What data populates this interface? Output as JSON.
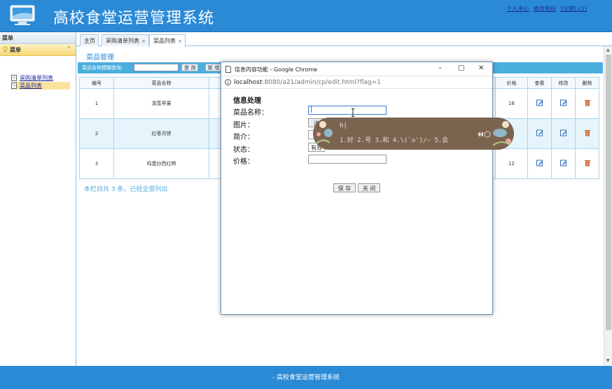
{
  "header": {
    "app_title": "高校食堂运营管理系统",
    "links": [
      "个人中心",
      "修改密码",
      "[注销]:c1)"
    ]
  },
  "sidebar": {
    "head": "菜单",
    "group": "菜单",
    "items": [
      {
        "label": "采购清单列表",
        "active": false
      },
      {
        "label": "菜品列表",
        "active": true
      }
    ]
  },
  "tabs": [
    {
      "label": "主页",
      "closable": false
    },
    {
      "label": "采购清单列表",
      "closable": true
    },
    {
      "label": "菜品列表",
      "closable": true,
      "active": true
    }
  ],
  "main": {
    "panel_title": "菜品管理",
    "search_label": "菜品名称模糊查询:",
    "search_value": "",
    "query_button": "查 询",
    "add_button": "新 增",
    "columns": [
      "编号",
      "菜品名称",
      "价格",
      "查看",
      "修改",
      "删除"
    ],
    "rows": [
      {
        "id": "1",
        "name": "清蒸苹果",
        "price": "16"
      },
      {
        "id": "2",
        "name": "红枣月饼",
        "price": ""
      },
      {
        "id": "3",
        "name": "鸡蛋炒西红柿",
        "price": "12"
      }
    ],
    "footnote": "本栏目共 3 条，已经全部列出"
  },
  "popup": {
    "title": "信息内容功能 - Google Chrome",
    "url_host": "localhost",
    "url_rest": ":8080/a21/admin/cp/edit.html?flag=1",
    "form_heading": "信息处理",
    "fields": {
      "name_label": "菜品名称：",
      "name_value": "|",
      "image_label": "图片：",
      "image_button": "选",
      "intro_label": "简介：",
      "status_label": "状态：",
      "status_value": "有效",
      "price_label": "价格：",
      "price_value": ""
    },
    "save_button": "保 存",
    "close_button": "关 闭"
  },
  "ime": {
    "typed": "h|",
    "candidates": "1.好  2.号  3.和  4.\\(`o')/~ 5.会"
  },
  "footer": {
    "text": "- 高校食堂运营管理系统"
  },
  "colors": {
    "brand_blue": "#2b8ad6",
    "search_bar": "#4aaede",
    "delete_icon": "#d35a2a",
    "edit_icon": "#2b6cb8",
    "ime_bg": "#7a6450"
  },
  "icons": {
    "view": "edit-note-icon",
    "edit": "edit-note-icon",
    "delete": "trash-icon"
  }
}
